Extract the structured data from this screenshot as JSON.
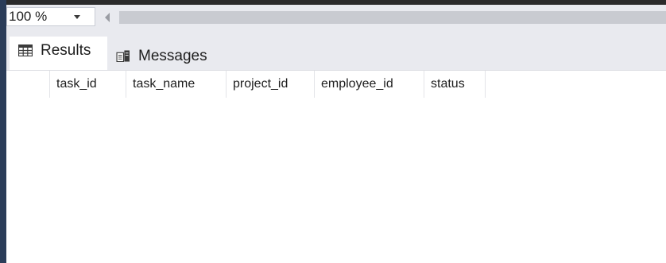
{
  "toolbar": {
    "zoom_value": "100 %"
  },
  "tabs": [
    {
      "label": "Results",
      "icon": "grid-icon",
      "active": true
    },
    {
      "label": "Messages",
      "icon": "messages-icon",
      "active": false
    }
  ],
  "grid": {
    "columns": [
      "task_id",
      "task_name",
      "project_id",
      "employee_id",
      "status"
    ],
    "rows": []
  },
  "colors": {
    "chrome_bg": "#e9eaef",
    "accent_border": "#2b3d59",
    "scroll_track": "#c9cbd1"
  }
}
